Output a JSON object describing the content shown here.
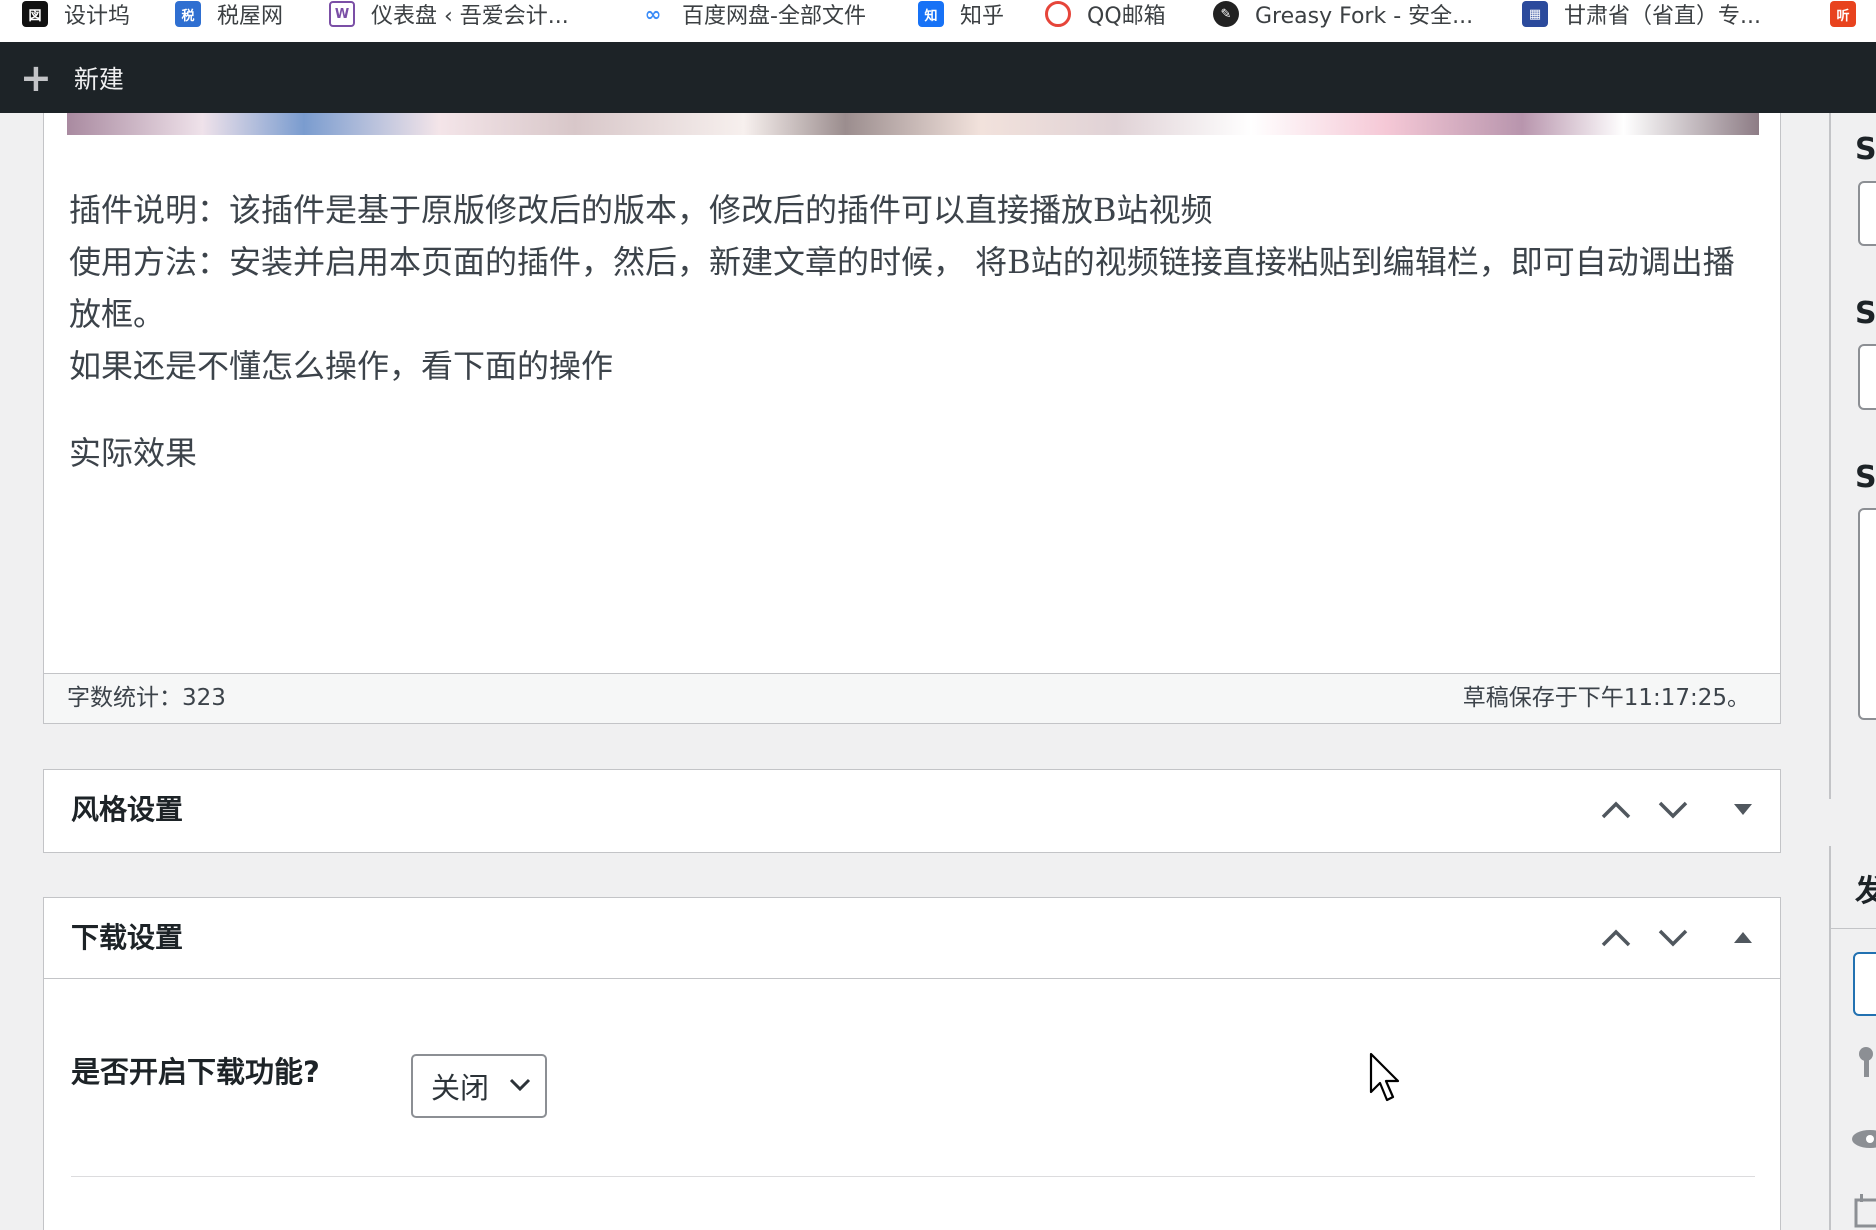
{
  "bookmarks": [
    {
      "label": "设计坞",
      "icon": "shejiwu-icon",
      "color": "#111111"
    },
    {
      "label": "税屋网",
      "icon": "shuiwu-icon",
      "color": "#2f6fd1"
    },
    {
      "label": "仪表盘 ‹ 吾爱会计...",
      "icon": "wordpress-w-icon",
      "color": "#7b4fa6"
    },
    {
      "label": "百度网盘-全部文件",
      "icon": "baidu-netdisk-icon",
      "color": "#3b8cf7"
    },
    {
      "label": "知乎",
      "icon": "zhihu-icon",
      "color": "#1772f6"
    },
    {
      "label": "QQ邮箱",
      "icon": "qq-mail-icon",
      "color": "#e6453a"
    },
    {
      "label": "Greasy Fork - 安全...",
      "icon": "greasy-fork-icon",
      "color": "#222222"
    },
    {
      "label": "甘肃省（省直）专...",
      "icon": "gansu-site-icon",
      "color": "#2b4a9c"
    },
    {
      "label": "听",
      "icon": "ting-icon",
      "color": "#e8431e"
    }
  ],
  "adminbar": {
    "new_label": "新建"
  },
  "editor": {
    "paragraphs": [
      "插件说明：该插件是基于原版修改后的版本，修改后的插件可以直接播放B站视频",
      "使用方法：安装并启用本页面的插件，然后，新建文章的时候， 将B站的视频链接直接粘贴到编辑栏，即可自动调出播放框。",
      "如果还是不懂怎么操作，看下面的操作",
      "实际效果"
    ],
    "word_count": "字数统计：323",
    "draft_saved": "草稿保存于下午11:17:25。"
  },
  "style_box": {
    "title": "风格设置",
    "state": "collapsed"
  },
  "download_box": {
    "title": "下载设置",
    "state": "expanded",
    "field_label": "是否开启下载功能?",
    "select_value": "关闭"
  },
  "sidebar": {
    "letters": [
      "S",
      "S",
      "S",
      "发"
    ]
  },
  "colors": {
    "adminbar": "#1d2327",
    "accent": "#2271b1",
    "border": "#c3c4c7"
  }
}
